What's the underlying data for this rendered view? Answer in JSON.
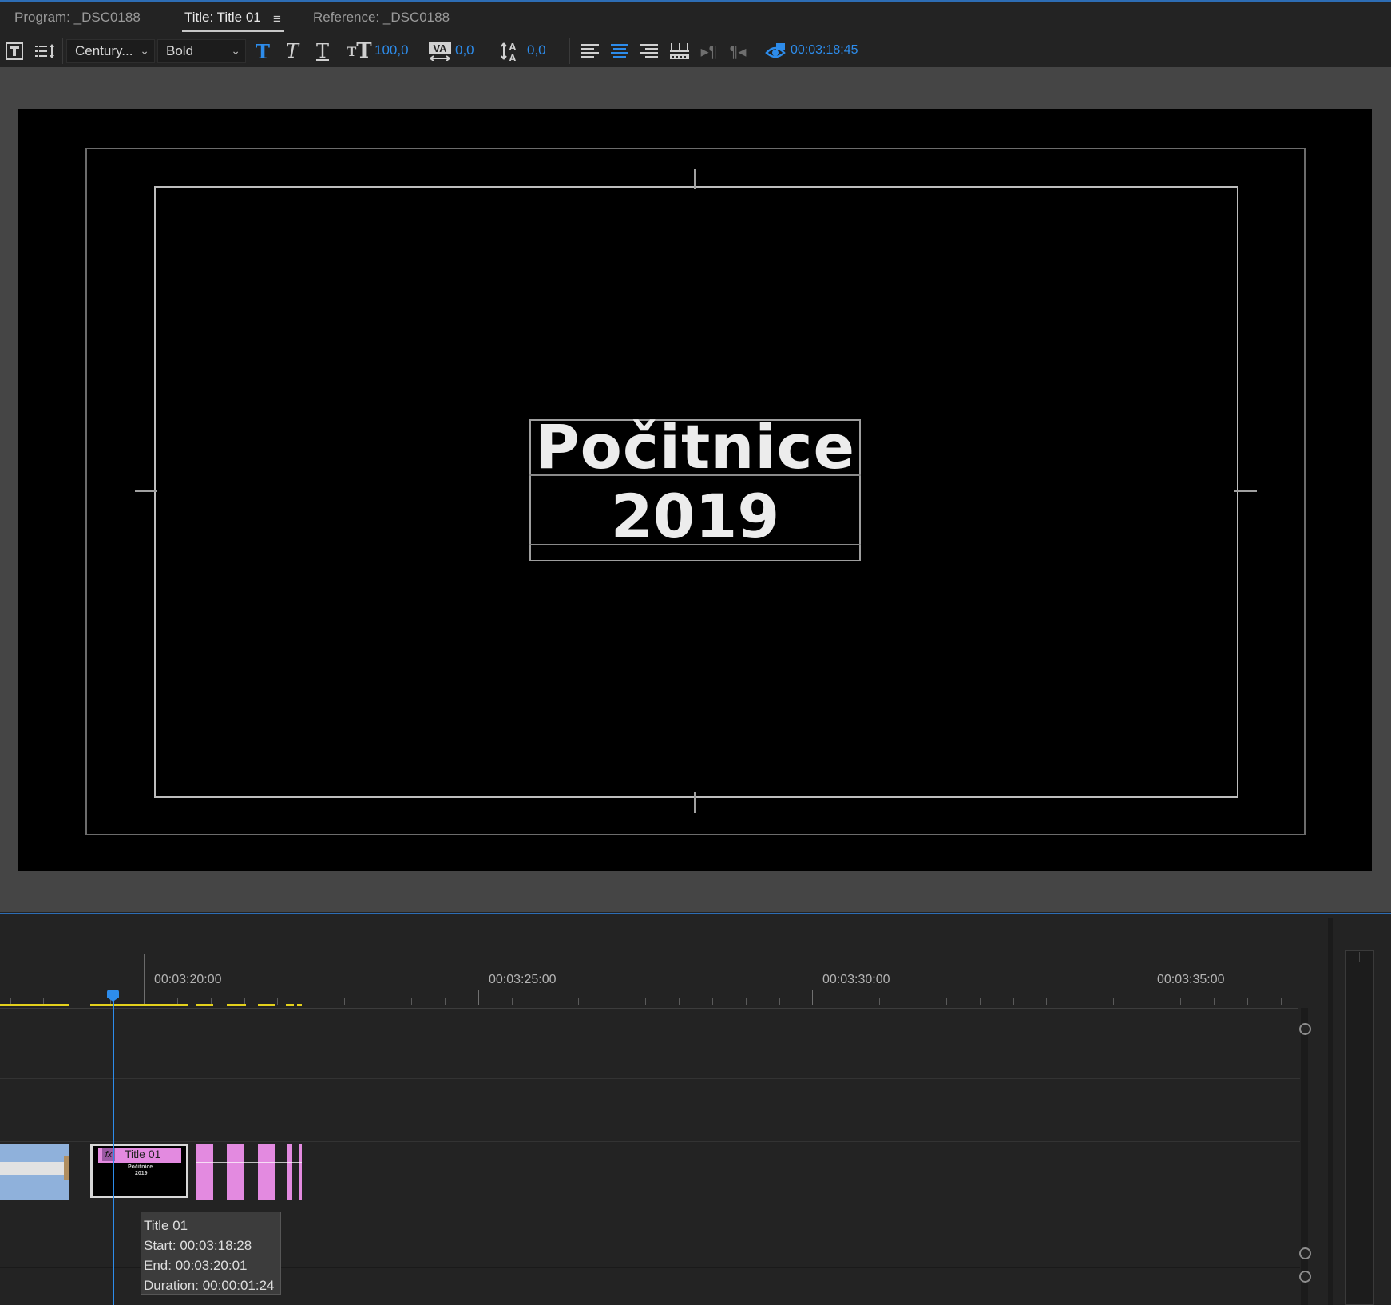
{
  "tabs": {
    "program": "Program: _DSC0188",
    "title": "Title: Title 01",
    "reference": "Reference: _DSC0188",
    "menu_icon": "≡"
  },
  "toolbar": {
    "font_family": "Century...",
    "font_style": "Bold",
    "font_size": "100,0",
    "kerning": "0,0",
    "leading": "0,0",
    "timecode": "00:03:18:45"
  },
  "canvas": {
    "line1": "Počitnice",
    "line2": "2019"
  },
  "timeline": {
    "ruler_labels": [
      "00:03:20:00",
      "00:03:25:00",
      "00:03:30:00",
      "00:03:35:00"
    ],
    "clip_label": "Title 01",
    "clip_fx": "fx",
    "thumb_line1": "Počitnice",
    "thumb_line2": "2019",
    "tooltip": {
      "name": "Title 01",
      "start": "Start: 00:03:18:28",
      "end": "End: 00:03:20:01",
      "duration": "Duration: 00:00:01:24"
    }
  },
  "colors": {
    "accent_blue": "#2d8ceb",
    "title_clip_pink": "#e38ae0",
    "video_clip_blue": "#8fb1db",
    "work_area_yellow": "#e3d01c"
  }
}
